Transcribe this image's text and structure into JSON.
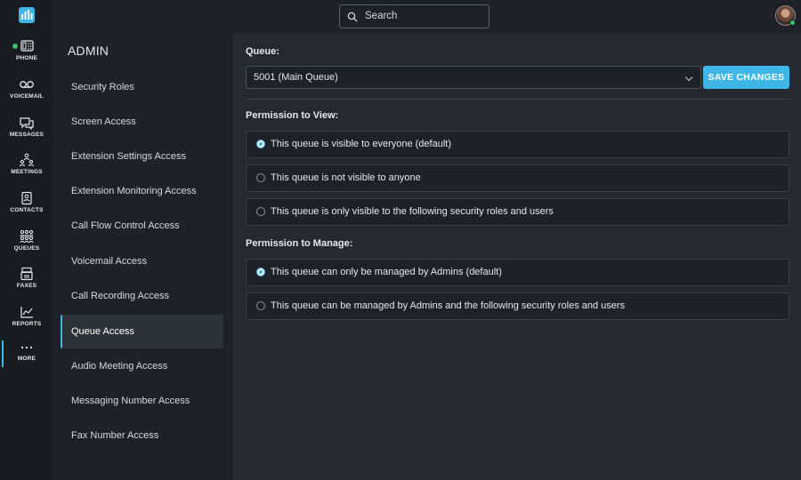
{
  "search": {
    "placeholder": "Search"
  },
  "rail": {
    "items": [
      {
        "label": "PHONE",
        "icon": "phone-icon"
      },
      {
        "label": "VOICEMAIL",
        "icon": "voicemail-icon"
      },
      {
        "label": "MESSAGES",
        "icon": "messages-icon"
      },
      {
        "label": "MEETINGS",
        "icon": "meetings-icon"
      },
      {
        "label": "CONTACTS",
        "icon": "contacts-icon"
      },
      {
        "label": "QUEUES",
        "icon": "queues-icon"
      },
      {
        "label": "FAXES",
        "icon": "fax-icon"
      },
      {
        "label": "REPORTS",
        "icon": "reports-icon"
      },
      {
        "label": "MORE",
        "icon": "more-icon"
      }
    ]
  },
  "admin": {
    "title": "ADMIN",
    "items": [
      "Security Roles",
      "Screen Access",
      "Extension Settings Access",
      "Extension Monitoring Access",
      "Call Flow Control Access",
      "Voicemail Access",
      "Call Recording Access",
      "Queue Access",
      "Audio Meeting Access",
      "Messaging Number Access",
      "Fax Number Access"
    ],
    "selected": "Queue Access"
  },
  "main": {
    "queue_label": "Queue:",
    "queue_value": "5001 (Main Queue)",
    "save_label": "SAVE CHANGES",
    "view_heading": "Permission to View:",
    "view_options": [
      {
        "label": "This queue is visible to everyone (default)",
        "selected": true
      },
      {
        "label": "This queue is not visible to anyone",
        "selected": false
      },
      {
        "label": "This queue is only visible to the following security roles and users",
        "selected": false
      }
    ],
    "manage_heading": "Permission to Manage:",
    "manage_options": [
      {
        "label": "This queue can only be managed by Admins (default)",
        "selected": true
      },
      {
        "label": "This queue can be managed by Admins and the following security roles and users",
        "selected": false
      }
    ]
  },
  "colors": {
    "accent": "#3fb6e8",
    "online": "#35c16a",
    "rail_bg": "#181b1f",
    "panel_bg": "#262a30"
  }
}
